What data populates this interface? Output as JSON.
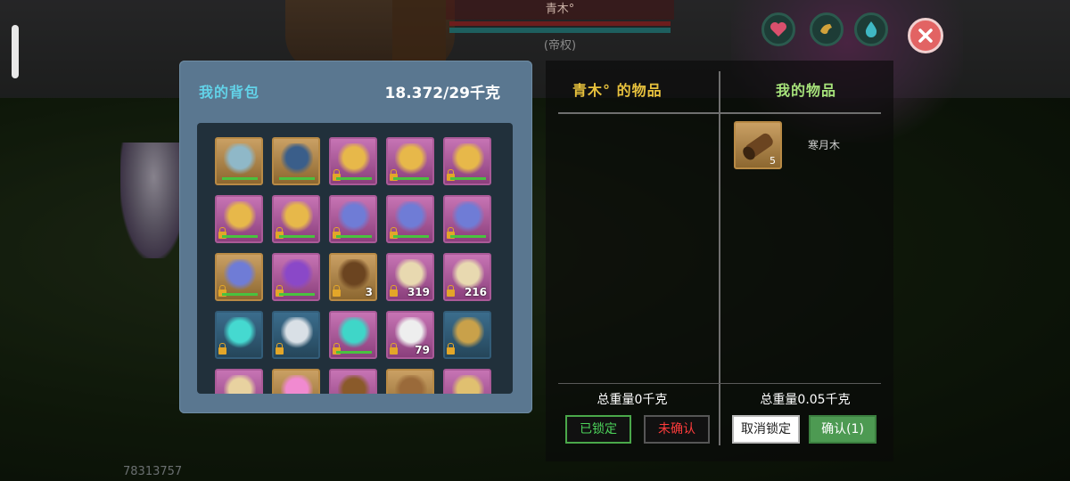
{
  "background": {
    "player_id": "78313757"
  },
  "target": {
    "name": "青木°",
    "title": "(帝权)"
  },
  "top_buttons": {
    "favorite_icon": "heart-icon",
    "gesture_icon": "hand-icon",
    "water_icon": "water-drop-icon",
    "close_icon": "close-icon"
  },
  "bag": {
    "title": "我的背包",
    "weight": "18.372/29千克",
    "slots": [
      {
        "frame": "gold",
        "icon": "armor-icon",
        "count": "",
        "lock": false,
        "durability": true
      },
      {
        "frame": "gold",
        "icon": "leggings-icon",
        "count": "",
        "lock": false,
        "durability": true
      },
      {
        "frame": "pink",
        "icon": "gem-amulet-icon",
        "count": "",
        "lock": true,
        "durability": true
      },
      {
        "frame": "pink",
        "icon": "gem-amulet-icon",
        "count": "",
        "lock": true,
        "durability": true
      },
      {
        "frame": "pink",
        "icon": "gem-amulet-icon",
        "count": "",
        "lock": true,
        "durability": true
      },
      {
        "frame": "pink",
        "icon": "gem-amulet-icon",
        "count": "",
        "lock": true,
        "durability": true
      },
      {
        "frame": "pink",
        "icon": "gem-amulet-icon",
        "count": "",
        "lock": true,
        "durability": true
      },
      {
        "frame": "pink",
        "icon": "blue-gem-amulet-icon",
        "count": "",
        "lock": true,
        "durability": true
      },
      {
        "frame": "pink",
        "icon": "blue-gem-amulet-icon",
        "count": "",
        "lock": true,
        "durability": true
      },
      {
        "frame": "pink",
        "icon": "blue-gem-amulet-icon",
        "count": "",
        "lock": true,
        "durability": true
      },
      {
        "frame": "gold",
        "icon": "blue-gem-amulet-icon",
        "count": "",
        "lock": true,
        "durability": true
      },
      {
        "frame": "pink",
        "icon": "purple-gem-amulet-icon",
        "count": "",
        "lock": true,
        "durability": true
      },
      {
        "frame": "gold",
        "icon": "wood-log-icon",
        "count": "3",
        "lock": true,
        "durability": false
      },
      {
        "frame": "pink",
        "icon": "wanted-poster-icon",
        "count": "319",
        "lock": true,
        "durability": false
      },
      {
        "frame": "pink",
        "icon": "wanted-poster-icon",
        "count": "216",
        "lock": true,
        "durability": false
      },
      {
        "frame": "blue",
        "icon": "cyan-egg-icon",
        "count": "",
        "lock": true,
        "durability": false
      },
      {
        "frame": "blue",
        "icon": "eye-stone-icon",
        "count": "",
        "lock": true,
        "durability": false
      },
      {
        "frame": "pink",
        "icon": "crystal-ball-icon",
        "count": "",
        "lock": true,
        "durability": true
      },
      {
        "frame": "pink",
        "icon": "megaphone-icon",
        "count": "79",
        "lock": true,
        "durability": false
      },
      {
        "frame": "blue",
        "icon": "drone-icon",
        "count": "",
        "lock": true,
        "durability": false
      },
      {
        "frame": "pink",
        "icon": "scroll-icon",
        "count": "",
        "lock": false,
        "durability": false
      },
      {
        "frame": "gold",
        "icon": "pink-crystal-icon",
        "count": "",
        "lock": false,
        "durability": false
      },
      {
        "frame": "pink",
        "icon": "plank-icon",
        "count": "",
        "lock": false,
        "durability": false
      },
      {
        "frame": "gold",
        "icon": "hammer-icon",
        "count": "",
        "lock": false,
        "durability": false
      },
      {
        "frame": "pink",
        "icon": "turret-icon",
        "count": "",
        "lock": false,
        "durability": false
      }
    ]
  },
  "trade": {
    "other_title": "青木° 的物品",
    "my_title": "我的物品",
    "my_item": {
      "icon": "wood-log-icon",
      "count": "5",
      "name": "寒月木"
    },
    "other_total": "总重量0千克",
    "my_total": "总重量0.05千克",
    "btn_locked": "已锁定",
    "btn_unconfirmed": "未确认",
    "btn_unlock": "取消锁定",
    "btn_confirm": "确认(1)",
    "colors": {
      "other_title": "#e8c23d",
      "my_title": "#a6e27a",
      "locked": "#4cd25a",
      "unconfirmed": "#ff3c3c",
      "confirm_bg": "#4d9a52"
    }
  }
}
